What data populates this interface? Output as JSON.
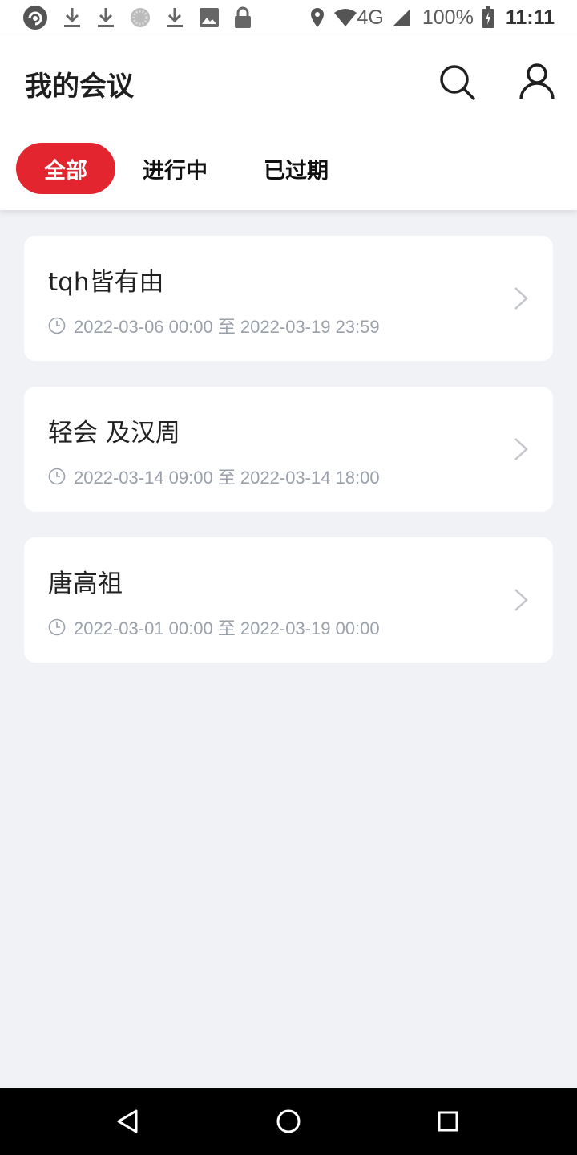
{
  "status_bar": {
    "network": "4G",
    "battery": "100%",
    "time": "11:11",
    "left_icons": [
      "app-icon",
      "download-icon",
      "download-icon",
      "loading-icon",
      "download-icon",
      "image-icon",
      "lock-icon"
    ],
    "right_icons": [
      "location-icon",
      "wifi-icon",
      "signal-icon",
      "battery-icon"
    ]
  },
  "header": {
    "title": "我的会议",
    "icons": [
      "search-icon",
      "user-icon"
    ]
  },
  "tabs": [
    {
      "label": "全部",
      "active": true
    },
    {
      "label": "进行中",
      "active": false
    },
    {
      "label": "已过期",
      "active": false
    }
  ],
  "meetings": [
    {
      "title": "tqh皆有由",
      "time": "2022-03-06 00:00 至 2022-03-19 23:59"
    },
    {
      "title": "轻会 及汉周",
      "time": "2022-03-14 09:00 至 2022-03-14 18:00"
    },
    {
      "title": "唐高祖",
      "time": "2022-03-01 00:00 至 2022-03-19 00:00"
    }
  ],
  "colors": {
    "accent": "#e2252f",
    "background": "#f1f2f6",
    "time_text": "#9aa1ab"
  },
  "nav_bar": {
    "icons": [
      "back-icon",
      "home-icon",
      "recent-apps-icon"
    ]
  }
}
